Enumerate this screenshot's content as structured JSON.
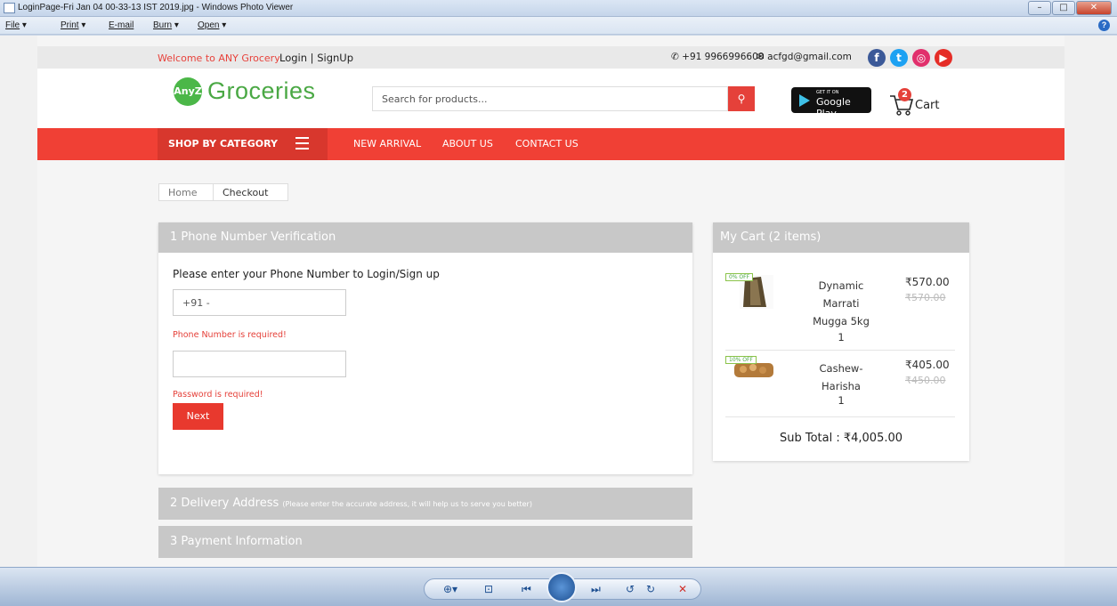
{
  "window": {
    "title": "LoginPage-Fri Jan 04 00-33-13 IST 2019.jpg - Windows Photo Viewer",
    "min": "–",
    "max": "□",
    "close": "✕"
  },
  "menu": {
    "file": "File",
    "print": "Print",
    "email": "E-mail",
    "burn": "Burn",
    "open": "Open",
    "dropdown": "▾",
    "help": "?"
  },
  "topbar": {
    "welcome": "Welcome to ANY Grocery",
    "login": "Login | SignUp",
    "phone": "+91 9966996600",
    "email": "acfgd@gmail.com",
    "social": [
      "f",
      "t",
      "◎",
      "▶"
    ],
    "social_colors": [
      "#3b5998",
      "#1da1f2",
      "#e1306c",
      "#e52d27"
    ]
  },
  "header": {
    "logo_badge": "AnyZ",
    "logo": "Groceries",
    "search_placeholder": "Search for products...",
    "search_icon": "⚲",
    "gplay_small": "GET IT ON",
    "gplay_big": "Google Play",
    "cart_count": "2",
    "cart_label": "Cart"
  },
  "nav": {
    "shop_by_category": "SHOP BY CATEGORY",
    "links": [
      "NEW ARRIVAL",
      "ABOUT US",
      "CONTACT US"
    ]
  },
  "breadcrumb": [
    "Home",
    "Checkout"
  ],
  "checkout": {
    "step1": "1  Phone Number Verification",
    "prompt": "Please enter your Phone Number to Login/Sign up",
    "phone_value": "+91 -",
    "phone_error": "Phone Number is required!",
    "password_value": "",
    "password_error": "Password is required!",
    "next": "Next",
    "step2": "2  Delivery Address",
    "step2_note": "(Please enter the accurate address, it will help us to serve you better)",
    "step3": "3  Payment Information"
  },
  "cart": {
    "title": "My Cart (2 items)",
    "items": [
      {
        "off": "0% OFF",
        "name": "Dynamic Marrati Mugga 5kg",
        "qty": "1",
        "price": "₹570.00",
        "orig": "₹570.00"
      },
      {
        "off": "10% OFF",
        "name": "Cashew-Harisha",
        "qty": "1",
        "price": "₹405.00",
        "orig": "₹450.00"
      }
    ],
    "subtotal": "Sub Total : ₹4,005.00"
  },
  "viewer_controls": [
    "⊕▾",
    "⊡",
    "⏮",
    "⏭",
    "↺",
    "↻",
    "✕"
  ]
}
